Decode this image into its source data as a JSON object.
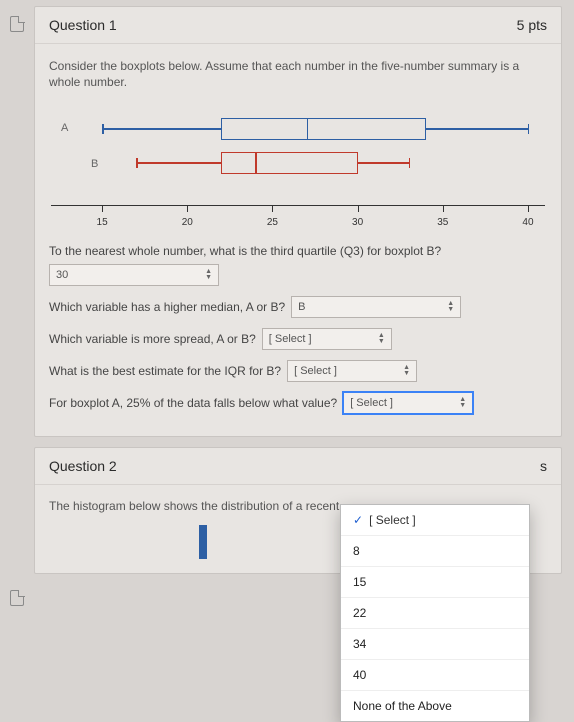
{
  "q1": {
    "title": "Question 1",
    "points": "5 pts",
    "intro": "Consider the boxplots below. Assume that each number in the five-number summary is a whole number.",
    "labelA": "A",
    "labelB": "B",
    "prompt_q3": "To the nearest whole number, what is the third quartile (Q3) for boxplot B?",
    "answer_q3": "30",
    "prompt_median": "Which variable has a higher median, A or B?",
    "answer_median": "B",
    "prompt_spread": "Which variable is more spread, A or B?",
    "answer_spread": "[ Select ]",
    "prompt_iqr": "What is the best estimate for the IQR for B?",
    "answer_iqr": "[ Select ]",
    "prompt_25": "For boxplot A, 25% of the data falls below what value?",
    "answer_25": "[ Select ]"
  },
  "dropdown": {
    "selected": "[ Select ]",
    "options": [
      "8",
      "15",
      "22",
      "34",
      "40",
      "None of the Above"
    ]
  },
  "q2": {
    "title": "Question 2",
    "points_suffix": "s",
    "body": "The histogram below shows the distribution of a recent"
  },
  "chart_data": {
    "type": "boxplot",
    "xaxis": {
      "ticks": [
        15,
        20,
        25,
        30,
        35,
        40
      ],
      "range": [
        12,
        41
      ]
    },
    "series": [
      {
        "name": "A",
        "color": "#2d5fa4",
        "min": 15,
        "q1": 22,
        "median": 27,
        "q3": 34,
        "max": 40
      },
      {
        "name": "B",
        "color": "#c0392b",
        "min": 17,
        "q1": 22,
        "median": 24,
        "q3": 30,
        "max": 33
      }
    ]
  }
}
